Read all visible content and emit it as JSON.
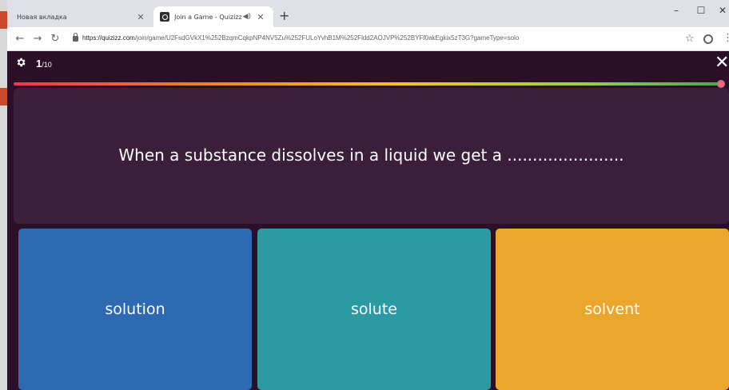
{
  "browser": {
    "tabs": [
      {
        "label": "Новая вкладка"
      },
      {
        "label": "Join a Game - Quizizz"
      }
    ],
    "new_tab": "+",
    "url_host": "https://quizizz.com",
    "url_path": "/join/game/U2FsdGVkX1%252BzqmCqkpNP4NV5Zu%252FULoYvhB1M%252Fldd2AOJVP%252BYFf0akEgkix5zT3G?gameType=solo",
    "window_controls": [
      "–",
      "☐",
      "✕"
    ]
  },
  "game": {
    "counter_current": "1",
    "counter_total": "/10",
    "progress": 1.0,
    "progress_colors": [
      "#e53b4c",
      "#f07a2d",
      "#f2c12e",
      "#9bd04c",
      "#4aa84a"
    ],
    "question": "When a substance dissolves in a liquid we get a .......................",
    "options": [
      {
        "label": "solution",
        "color": "#2d6ab1"
      },
      {
        "label": "solute",
        "color": "#2b9aa3"
      },
      {
        "label": "solvent",
        "color": "#eba62e"
      }
    ]
  },
  "icons": {
    "back": "back-arrow-icon",
    "forward": "forward-arrow-icon",
    "reload": "reload-icon",
    "lock": "lock-icon",
    "star": "star-icon",
    "account": "account-icon",
    "menu": "menu-icon",
    "settings": "gear-icon",
    "exit": "close-icon",
    "audio": "speaker-icon"
  }
}
